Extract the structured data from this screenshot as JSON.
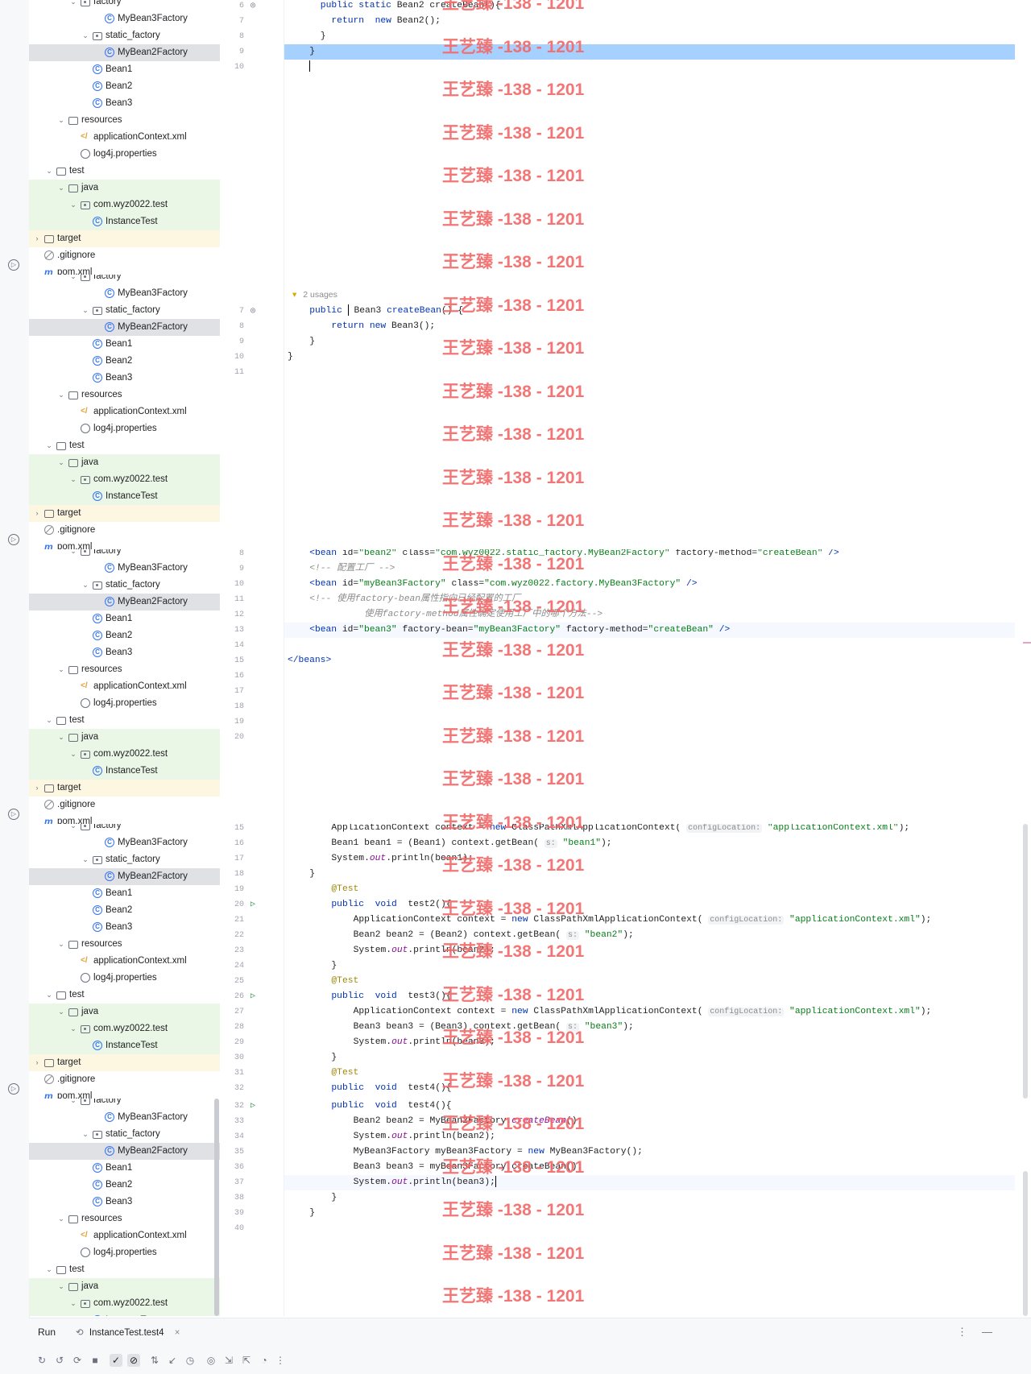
{
  "tree": {
    "rows": [
      {
        "label": "factory",
        "icon": "package-icon",
        "depth": 4,
        "chevron": "down"
      },
      {
        "label": "MyBean3Factory",
        "icon": "class-icon",
        "depth": 6,
        "chevron": ""
      },
      {
        "label": "static_factory",
        "icon": "package-icon",
        "depth": 5,
        "chevron": "down"
      },
      {
        "label": "MyBean2Factory",
        "icon": "class-icon",
        "depth": 6,
        "chevron": "",
        "selected": true
      },
      {
        "label": "Bean1",
        "icon": "class-icon",
        "depth": 5,
        "chevron": ""
      },
      {
        "label": "Bean2",
        "icon": "class-icon",
        "depth": 5,
        "chevron": ""
      },
      {
        "label": "Bean3",
        "icon": "class-icon",
        "depth": 5,
        "chevron": ""
      },
      {
        "label": "resources",
        "icon": "folder-icon",
        "depth": 3,
        "chevron": "down"
      },
      {
        "label": "applicationContext.xml",
        "icon": "xml-file-icon",
        "depth": 4,
        "chevron": ""
      },
      {
        "label": "log4j.properties",
        "icon": "properties-file-icon",
        "depth": 4,
        "chevron": ""
      },
      {
        "label": "test",
        "icon": "folder-icon",
        "depth": 2,
        "chevron": "down"
      },
      {
        "label": "java",
        "icon": "folder-icon",
        "depth": 3,
        "chevron": "down",
        "tint": "green"
      },
      {
        "label": "com.wyz0022.test",
        "icon": "package-icon",
        "depth": 4,
        "chevron": "down",
        "tint": "green"
      },
      {
        "label": "InstanceTest",
        "icon": "class-icon",
        "depth": 5,
        "chevron": "",
        "tint": "green"
      },
      {
        "label": "target",
        "icon": "folder-icon",
        "depth": 1,
        "chevron": "right",
        "tint": "yellow"
      },
      {
        "label": ".gitignore",
        "icon": "gitignore-icon",
        "depth": 1,
        "chevron": ""
      },
      {
        "label": "pom.xml",
        "icon": "maven-icon",
        "depth": 1,
        "chevron": ""
      }
    ]
  },
  "editor1": {
    "lines": [
      {
        "n": "6",
        "mark": "impl",
        "indent": 3,
        "segs": [
          [
            "kw",
            "public static "
          ],
          [
            "",
            "Bean2 createBean(){"
          ]
        ]
      },
      {
        "n": "7",
        "indent": 4,
        "segs": [
          [
            "kw",
            "return  new "
          ],
          [
            "",
            "Bean2();"
          ]
        ]
      },
      {
        "n": "8",
        "indent": 3,
        "segs": [
          [
            "",
            "}"
          ]
        ]
      },
      {
        "n": "9",
        "indent": 2,
        "segs": [
          [
            "",
            "}"
          ]
        ],
        "hl": "blue"
      },
      {
        "n": "10",
        "indent": 2,
        "segs": [],
        "caret": true
      }
    ]
  },
  "editor2": {
    "usages": "2 usages",
    "lines": [
      {
        "n": "7",
        "mark": "impl",
        "indent": 2,
        "segs": [
          [
            "kw",
            "public "
          ],
          [
            "",
            "Bean3 "
          ],
          [
            "kw",
            "createBean"
          ],
          [
            "",
            "() {"
          ]
        ],
        "caret_at": 1
      },
      {
        "n": "8",
        "indent": 4,
        "segs": [
          [
            "kw",
            "return new "
          ],
          [
            "",
            "Bean3();"
          ]
        ]
      },
      {
        "n": "9",
        "indent": 2,
        "segs": [
          [
            "",
            "}"
          ]
        ]
      },
      {
        "n": "10",
        "indent": 0,
        "segs": [
          [
            "",
            "}"
          ]
        ]
      },
      {
        "n": "11",
        "indent": 0,
        "segs": []
      }
    ]
  },
  "editor3": {
    "lines": [
      {
        "n": "8",
        "indent": 2,
        "segs": [
          [
            "kw",
            "<bean "
          ],
          [
            "",
            "id="
          ],
          [
            "str",
            "\"bean2\" "
          ],
          [
            "",
            "class="
          ],
          [
            "str",
            "\"com.wyz0022.static_factory.MyBean2Factory\" "
          ],
          [
            "",
            "factory-method="
          ],
          [
            "str",
            "\"createBean\" "
          ],
          [
            "kw",
            "/>"
          ]
        ]
      },
      {
        "n": "9",
        "indent": 2,
        "segs": [
          [
            "cmt",
            "<!-- 配置工厂 -->"
          ]
        ]
      },
      {
        "n": "10",
        "indent": 2,
        "segs": [
          [
            "kw",
            "<bean "
          ],
          [
            "",
            "id="
          ],
          [
            "str",
            "\"myBean3Factory\" "
          ],
          [
            "",
            "class="
          ],
          [
            "str",
            "\"com.wyz0022.factory.MyBean3Factory\" "
          ],
          [
            "kw",
            "/>"
          ]
        ]
      },
      {
        "n": "11",
        "indent": 2,
        "segs": [
          [
            "cmt",
            "<!-- 使用factory-bean属性指向已经配置的工厂"
          ]
        ]
      },
      {
        "n": "12",
        "indent": 7,
        "segs": [
          [
            "cmt",
            "使用factory-method属性确定使用工厂中的哪个方法-->"
          ]
        ]
      },
      {
        "n": "13",
        "indent": 2,
        "segs": [
          [
            "kw",
            "<bean "
          ],
          [
            "",
            "id="
          ],
          [
            "str",
            "\"bean3\" "
          ],
          [
            "",
            "factory-bean="
          ],
          [
            "str",
            "\"myBean3Factory\" "
          ],
          [
            "",
            "factory-method="
          ],
          [
            "str",
            "\"createBean\" "
          ],
          [
            "kw",
            "/>"
          ]
        ],
        "hl": "faint"
      },
      {
        "n": "14",
        "indent": 0,
        "segs": []
      },
      {
        "n": "15",
        "indent": 0,
        "segs": [
          [
            "kw",
            "</beans>"
          ]
        ]
      },
      {
        "n": "16",
        "indent": 0,
        "segs": []
      },
      {
        "n": "17",
        "indent": 0,
        "segs": []
      },
      {
        "n": "18",
        "indent": 0,
        "segs": []
      },
      {
        "n": "19",
        "indent": 0,
        "segs": []
      },
      {
        "n": "20",
        "indent": 0,
        "segs": []
      }
    ]
  },
  "editor4": {
    "lines": [
      {
        "n": "15",
        "indent": 4,
        "segs": [
          [
            "",
            "ApplicationContext context = "
          ],
          [
            "kw",
            "new "
          ],
          [
            "",
            "ClassPathXmlApplicationContext( "
          ],
          [
            "hint",
            "configLocation:"
          ],
          [
            "str",
            " \"applicationContext.xml\""
          ],
          [
            "",
            ");"
          ]
        ]
      },
      {
        "n": "16",
        "indent": 4,
        "segs": [
          [
            "",
            "Bean1 bean1 = (Bean1) context.getBean( "
          ],
          [
            "hint",
            "s:"
          ],
          [
            "str",
            " \"bean1\""
          ],
          [
            "",
            ");"
          ]
        ]
      },
      {
        "n": "17",
        "indent": 4,
        "segs": [
          [
            "",
            "System."
          ],
          [
            "fld",
            "out"
          ],
          [
            "",
            ".println(bean1);"
          ]
        ]
      },
      {
        "n": "18",
        "indent": 2,
        "segs": [
          [
            "",
            "}"
          ]
        ]
      },
      {
        "n": "19",
        "indent": 4,
        "segs": [
          [
            "ann",
            "@Test"
          ]
        ]
      },
      {
        "n": "20",
        "mark": "run",
        "indent": 4,
        "segs": [
          [
            "kw",
            "public  void  "
          ],
          [
            "",
            "test2(){"
          ]
        ]
      },
      {
        "n": "21",
        "indent": 6,
        "segs": [
          [
            "",
            "ApplicationContext context = "
          ],
          [
            "kw",
            "new "
          ],
          [
            "",
            "ClassPathXmlApplicationContext( "
          ],
          [
            "hint",
            "configLocation:"
          ],
          [
            "str",
            " \"applicationContext.xml\""
          ],
          [
            "",
            ");"
          ]
        ]
      },
      {
        "n": "22",
        "indent": 6,
        "segs": [
          [
            "",
            "Bean2 bean2 = (Bean2) context.getBean( "
          ],
          [
            "hint",
            "s:"
          ],
          [
            "str",
            " \"bean2\""
          ],
          [
            "",
            ");"
          ]
        ]
      },
      {
        "n": "23",
        "indent": 6,
        "segs": [
          [
            "",
            "System."
          ],
          [
            "fld",
            "out"
          ],
          [
            "",
            ".println(bean2);"
          ]
        ]
      },
      {
        "n": "24",
        "indent": 4,
        "segs": [
          [
            "",
            "}"
          ]
        ]
      },
      {
        "n": "25",
        "indent": 4,
        "segs": [
          [
            "ann",
            "@Test"
          ]
        ]
      },
      {
        "n": "26",
        "mark": "run",
        "indent": 4,
        "segs": [
          [
            "kw",
            "public  void  "
          ],
          [
            "",
            "test3(){"
          ]
        ]
      },
      {
        "n": "27",
        "indent": 6,
        "segs": [
          [
            "",
            "ApplicationContext context = "
          ],
          [
            "kw",
            "new "
          ],
          [
            "",
            "ClassPathXmlApplicationContext( "
          ],
          [
            "hint",
            "configLocation:"
          ],
          [
            "str",
            " \"applicationContext.xml\""
          ],
          [
            "",
            ");"
          ]
        ]
      },
      {
        "n": "28",
        "indent": 6,
        "segs": [
          [
            "",
            "Bean3 bean3 = (Bean3) context.getBean( "
          ],
          [
            "hint",
            "s:"
          ],
          [
            "str",
            " \"bean3\""
          ],
          [
            "",
            ");"
          ]
        ]
      },
      {
        "n": "29",
        "indent": 6,
        "segs": [
          [
            "",
            "System."
          ],
          [
            "fld",
            "out"
          ],
          [
            "",
            ".println(bean3);"
          ]
        ]
      },
      {
        "n": "30",
        "indent": 4,
        "segs": [
          [
            "",
            "}"
          ]
        ]
      },
      {
        "n": "31",
        "indent": 4,
        "segs": [
          [
            "ann",
            "@Test"
          ]
        ]
      },
      {
        "n": "32",
        "indent": 4,
        "segs": [
          [
            "kw",
            "public  void  "
          ],
          [
            "",
            "test4(){"
          ]
        ]
      }
    ]
  },
  "editor5": {
    "lines": [
      {
        "n": "32",
        "mark": "run",
        "indent": 4,
        "segs": [
          [
            "kw",
            "public  void  "
          ],
          [
            "",
            "test4(){"
          ]
        ]
      },
      {
        "n": "33",
        "indent": 6,
        "segs": [
          [
            "",
            "Bean2 bean2 = MyBean2Factory."
          ],
          [
            "fld",
            "createBean"
          ],
          [
            "",
            "();"
          ]
        ]
      },
      {
        "n": "34",
        "indent": 6,
        "segs": [
          [
            "",
            "System."
          ],
          [
            "fld",
            "out"
          ],
          [
            "",
            ".println(bean2);"
          ]
        ]
      },
      {
        "n": "35",
        "indent": 6,
        "segs": [
          [
            "",
            "MyBean3Factory myBean3Factory = "
          ],
          [
            "kw",
            "new "
          ],
          [
            "",
            "MyBean3Factory();"
          ]
        ]
      },
      {
        "n": "36",
        "indent": 6,
        "segs": [
          [
            "",
            "Bean3 bean3 = myBean3Factory.createBean();"
          ]
        ]
      },
      {
        "n": "37",
        "indent": 6,
        "segs": [
          [
            "",
            "System."
          ],
          [
            "fld",
            "out"
          ],
          [
            "",
            ".println(bean3);"
          ]
        ],
        "hl": "faint",
        "caret": true
      },
      {
        "n": "38",
        "indent": 4,
        "segs": [
          [
            "",
            "}"
          ]
        ]
      },
      {
        "n": "39",
        "indent": 2,
        "segs": [
          [
            "",
            "}"
          ]
        ]
      },
      {
        "n": "40",
        "indent": 0,
        "segs": []
      }
    ]
  },
  "watermark": "王艺臻 -138 - 1201",
  "run_window": {
    "label": "Run",
    "tab_label": "InstanceTest.test4",
    "tab_icon": "test-config-icon"
  },
  "colors": {
    "accent_selection": "#a6d1ff",
    "watermark": "#f26b6b",
    "test_source_tint": "#eaf6e6",
    "excluded_tint": "#fdf7e2"
  }
}
